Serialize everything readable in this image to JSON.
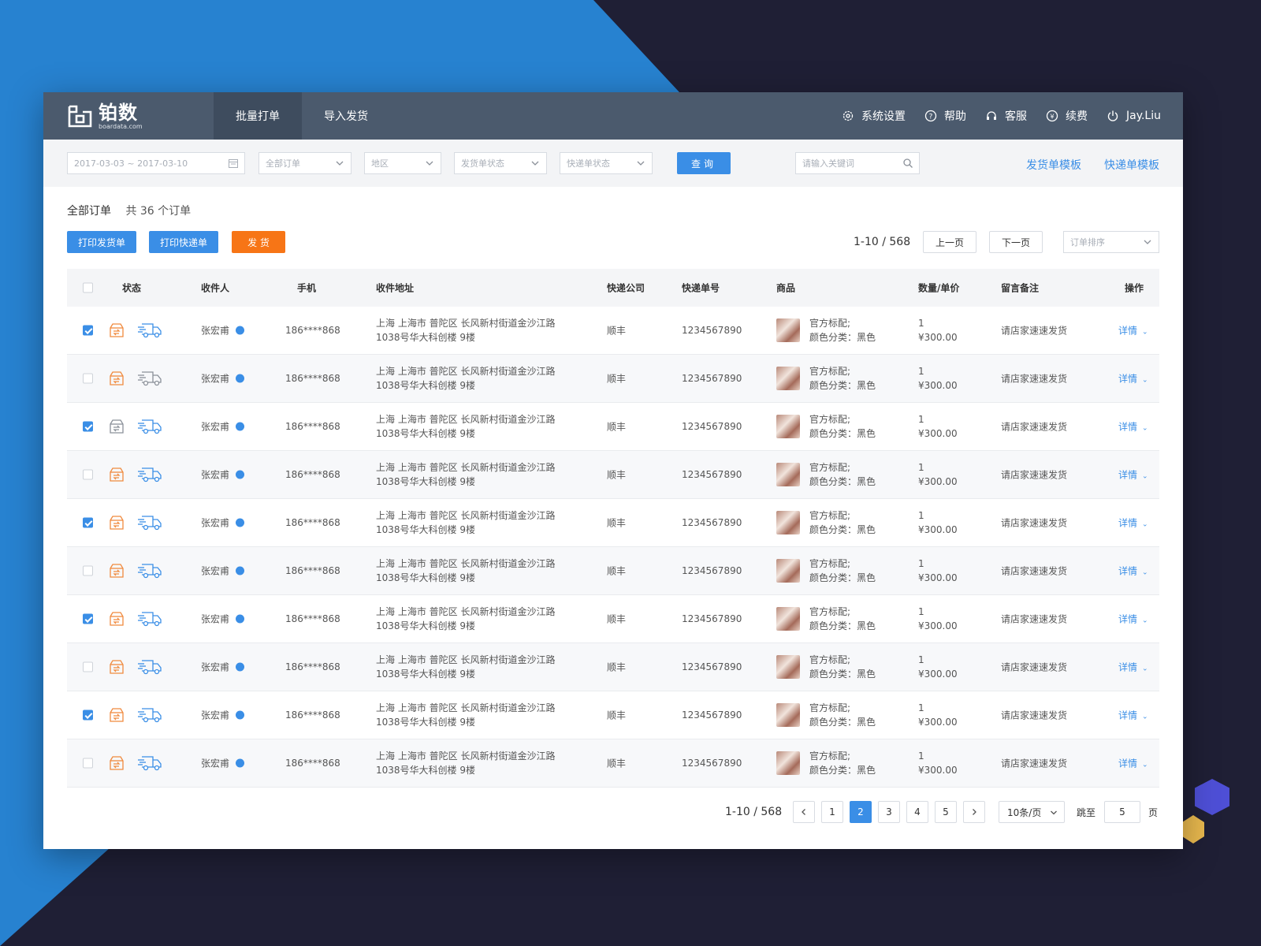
{
  "brand": {
    "name_cn": "铂数",
    "name_en": "boardata.com"
  },
  "nav": {
    "tabs": [
      {
        "label": "批量打单",
        "active": true
      },
      {
        "label": "导入发货",
        "active": false
      }
    ],
    "right": [
      {
        "label": "系统设置",
        "icon": "gear-icon"
      },
      {
        "label": "帮助",
        "icon": "help-icon"
      },
      {
        "label": "客服",
        "icon": "headset-icon"
      },
      {
        "label": "续费",
        "icon": "renew-icon"
      },
      {
        "label": "Jay.Liu",
        "icon": "power-icon"
      }
    ]
  },
  "filters": {
    "date_range": "2017-03-03 ~ 2017-03-10",
    "order_select": "全部订单",
    "region_select": "地区",
    "ship_status_select": "发货单状态",
    "express_status_select": "快递单状态",
    "query_button": "查询",
    "search_placeholder": "请输入关键词",
    "link_ship_template": "发货单模板",
    "link_express_template": "快递单模板"
  },
  "summary": {
    "title": "全部订单",
    "count_text": "共 36 个订单"
  },
  "actions": {
    "print_ship": "打印发货单",
    "print_express": "打印快递单",
    "ship": "发 货",
    "colors": {
      "primary": "#3a8ee6",
      "orange": "#f77516"
    }
  },
  "pager_top": {
    "range": "1-10 / 568",
    "prev": "上一页",
    "next": "下一页",
    "sort_placeholder": "订单排序"
  },
  "table": {
    "headers": [
      "状态",
      "收件人",
      "手机",
      "收件地址",
      "快递公司",
      "快递单号",
      "商品",
      "数量/单价",
      "留言备注",
      "操作"
    ],
    "rows": [
      {
        "checked": true,
        "name": "张宏甫",
        "phone": "186****868",
        "addr1": "上海 上海市 普陀区 长风新村街道金沙江路",
        "addr2": "1038号华大科创楼 9楼",
        "company": "顺丰",
        "tracking": "1234567890",
        "goods1": "官方标配;",
        "goods2": "颜色分类：黑色",
        "qty": "1",
        "price": "¥300.00",
        "note": "请店家速速发货",
        "op": "详情"
      },
      {
        "checked": false,
        "name": "张宏甫",
        "phone": "186****868",
        "addr1": "上海 上海市 普陀区 长风新村街道金沙江路",
        "addr2": "1038号华大科创楼 9楼",
        "company": "顺丰",
        "tracking": "1234567890",
        "goods1": "官方标配;",
        "goods2": "颜色分类：黑色",
        "qty": "1",
        "price": "¥300.00",
        "note": "请店家速速发货",
        "op": "详情"
      },
      {
        "checked": true,
        "name": "张宏甫",
        "phone": "186****868",
        "addr1": "上海 上海市 普陀区 长风新村街道金沙江路",
        "addr2": "1038号华大科创楼 9楼",
        "company": "顺丰",
        "tracking": "1234567890",
        "goods1": "官方标配;",
        "goods2": "颜色分类：黑色",
        "qty": "1",
        "price": "¥300.00",
        "note": "请店家速速发货",
        "op": "详情"
      },
      {
        "checked": false,
        "name": "张宏甫",
        "phone": "186****868",
        "addr1": "上海 上海市 普陀区 长风新村街道金沙江路",
        "addr2": "1038号华大科创楼 9楼",
        "company": "顺丰",
        "tracking": "1234567890",
        "goods1": "官方标配;",
        "goods2": "颜色分类：黑色",
        "qty": "1",
        "price": "¥300.00",
        "note": "请店家速速发货",
        "op": "详情"
      },
      {
        "checked": true,
        "name": "张宏甫",
        "phone": "186****868",
        "addr1": "上海 上海市 普陀区 长风新村街道金沙江路",
        "addr2": "1038号华大科创楼 9楼",
        "company": "顺丰",
        "tracking": "1234567890",
        "goods1": "官方标配;",
        "goods2": "颜色分类：黑色",
        "qty": "1",
        "price": "¥300.00",
        "note": "请店家速速发货",
        "op": "详情"
      },
      {
        "checked": false,
        "name": "张宏甫",
        "phone": "186****868",
        "addr1": "上海 上海市 普陀区 长风新村街道金沙江路",
        "addr2": "1038号华大科创楼 9楼",
        "company": "顺丰",
        "tracking": "1234567890",
        "goods1": "官方标配;",
        "goods2": "颜色分类：黑色",
        "qty": "1",
        "price": "¥300.00",
        "note": "请店家速速发货",
        "op": "详情"
      },
      {
        "checked": true,
        "name": "张宏甫",
        "phone": "186****868",
        "addr1": "上海 上海市 普陀区 长风新村街道金沙江路",
        "addr2": "1038号华大科创楼 9楼",
        "company": "顺丰",
        "tracking": "1234567890",
        "goods1": "官方标配;",
        "goods2": "颜色分类：黑色",
        "qty": "1",
        "price": "¥300.00",
        "note": "请店家速速发货",
        "op": "详情"
      },
      {
        "checked": false,
        "name": "张宏甫",
        "phone": "186****868",
        "addr1": "上海 上海市 普陀区 长风新村街道金沙江路",
        "addr2": "1038号华大科创楼 9楼",
        "company": "顺丰",
        "tracking": "1234567890",
        "goods1": "官方标配;",
        "goods2": "颜色分类：黑色",
        "qty": "1",
        "price": "¥300.00",
        "note": "请店家速速发货",
        "op": "详情"
      },
      {
        "checked": true,
        "name": "张宏甫",
        "phone": "186****868",
        "addr1": "上海 上海市 普陀区 长风新村街道金沙江路",
        "addr2": "1038号华大科创楼 9楼",
        "company": "顺丰",
        "tracking": "1234567890",
        "goods1": "官方标配;",
        "goods2": "颜色分类：黑色",
        "qty": "1",
        "price": "¥300.00",
        "note": "请店家速速发货",
        "op": "详情"
      },
      {
        "checked": false,
        "name": "张宏甫",
        "phone": "186****868",
        "addr1": "上海 上海市 普陀区 长风新村街道金沙江路",
        "addr2": "1038号华大科创楼 9楼",
        "company": "顺丰",
        "tracking": "1234567890",
        "goods1": "官方标配;",
        "goods2": "颜色分类：黑色",
        "qty": "1",
        "price": "¥300.00",
        "note": "请店家速速发货",
        "op": "详情"
      }
    ]
  },
  "pager_bottom": {
    "range": "1-10 / 568",
    "pages": [
      "1",
      "2",
      "3",
      "4",
      "5"
    ],
    "active_page": "2",
    "page_size": "10条/页",
    "jump_label": "跳至",
    "jump_value": "5",
    "page_unit": "页"
  }
}
